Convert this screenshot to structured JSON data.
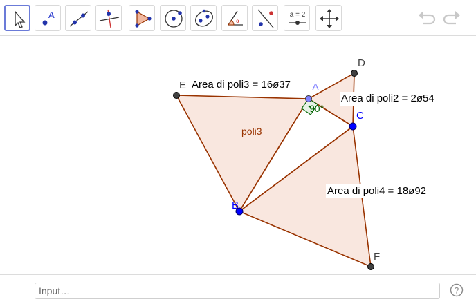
{
  "toolbar": {
    "tools": [
      {
        "name": "move-tool",
        "label": "move"
      },
      {
        "name": "point-tool",
        "label": "A"
      },
      {
        "name": "line-tool",
        "label": "line"
      },
      {
        "name": "perpendicular-line-tool",
        "label": "perpendicular"
      },
      {
        "name": "polygon-tool",
        "label": "polygon"
      },
      {
        "name": "circle-center-point-tool",
        "label": "circle"
      },
      {
        "name": "ellipse-tool",
        "label": "conic"
      },
      {
        "name": "angle-tool",
        "label": "angle"
      },
      {
        "name": "reflect-tool",
        "label": "reflect"
      },
      {
        "name": "slider-tool",
        "label": "a = 2"
      },
      {
        "name": "move-graphics-view-tool",
        "label": "pan"
      }
    ],
    "slider_text": "a = 2",
    "point_text": "A",
    "undo": "undo",
    "redo": "redo"
  },
  "graphics": {
    "points": {
      "A": {
        "label": "A",
        "color": "#8080ff"
      },
      "B": {
        "label": "B",
        "color": "#0000ff"
      },
      "C": {
        "label": "C",
        "color": "#0000ff"
      },
      "D": {
        "label": "D",
        "color": "#404040"
      },
      "E": {
        "label": "E",
        "color": "#404040"
      },
      "F": {
        "label": "F",
        "color": "#404040"
      }
    },
    "polygon_name": "poli3",
    "angle_text": "90°",
    "area_labels": {
      "poli3": "Area di poli3 = 16ø37",
      "poli2": "Area di poli2 = 2ø54",
      "poli4": "Area di poli4 = 18ø92"
    },
    "colors": {
      "polygon_fill": "#f9e7df",
      "polygon_edge": "#993300",
      "angle_fill": "#e6f2e6",
      "angle_edge": "#006400"
    }
  },
  "input_bar": {
    "placeholder": "Input…",
    "help": "?"
  }
}
